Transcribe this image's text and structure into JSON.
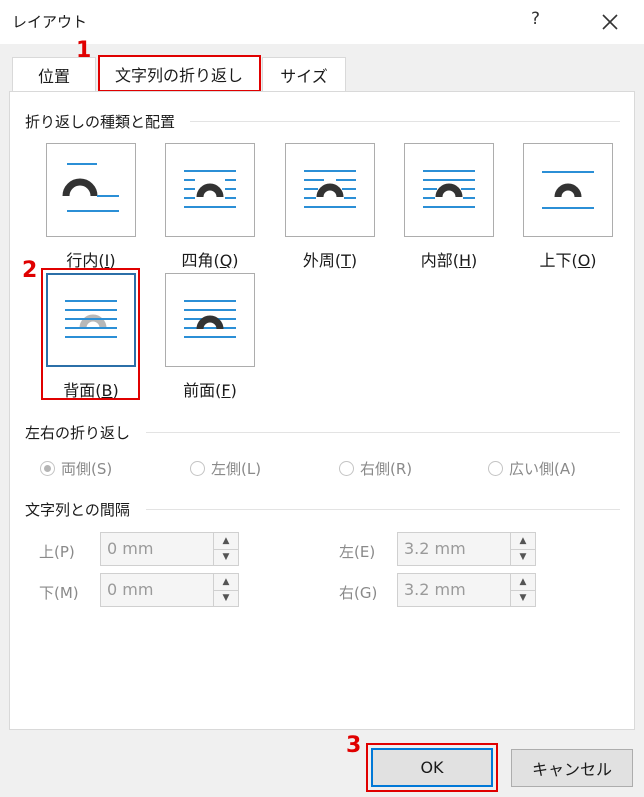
{
  "window": {
    "title": "レイアウト",
    "help": "?"
  },
  "tabs": [
    {
      "label": "位置"
    },
    {
      "label": "文字列の折り返し",
      "active": true
    },
    {
      "label": "サイズ"
    }
  ],
  "annotations": [
    "1",
    "2",
    "3"
  ],
  "wrapping_style": {
    "heading": "折り返しの種類と配置",
    "selected": "背面(B)",
    "options": [
      {
        "label": "行内(",
        "key": "I",
        "end": ")",
        "icon": "inline-icon"
      },
      {
        "label": "四角(",
        "key": "Q",
        "end": ")",
        "icon": "square-icon"
      },
      {
        "label": "外周(",
        "key": "T",
        "end": ")",
        "icon": "tight-icon"
      },
      {
        "label": "内部(",
        "key": "H",
        "end": ")",
        "icon": "through-icon"
      },
      {
        "label": "上下(",
        "key": "O",
        "end": ")",
        "icon": "top-bottom-icon"
      },
      {
        "label": "背面(",
        "key": "B",
        "end": ")",
        "icon": "behind-text-icon"
      },
      {
        "label": "前面(",
        "key": "F",
        "end": ")",
        "icon": "in-front-icon"
      }
    ]
  },
  "wrap_text": {
    "heading": "左右の折り返し",
    "options": [
      "両側(S)",
      "左側(L)",
      "右側(R)",
      "広い側(A)"
    ],
    "selected": "両側(S)"
  },
  "distance": {
    "heading": "文字列との間隔",
    "top": {
      "label": "上(P)",
      "value": "0 mm"
    },
    "bottom": {
      "label": "下(M)",
      "value": "0 mm"
    },
    "left": {
      "label": "左(E)",
      "value": "3.2 mm"
    },
    "right": {
      "label": "右(G)",
      "value": "3.2 mm"
    }
  },
  "buttons": {
    "ok": "OK",
    "cancel": "キャンセル"
  },
  "colors": {
    "accent": "#0078d7",
    "highlight": "#e00000",
    "lines": "#2b8fd6"
  }
}
